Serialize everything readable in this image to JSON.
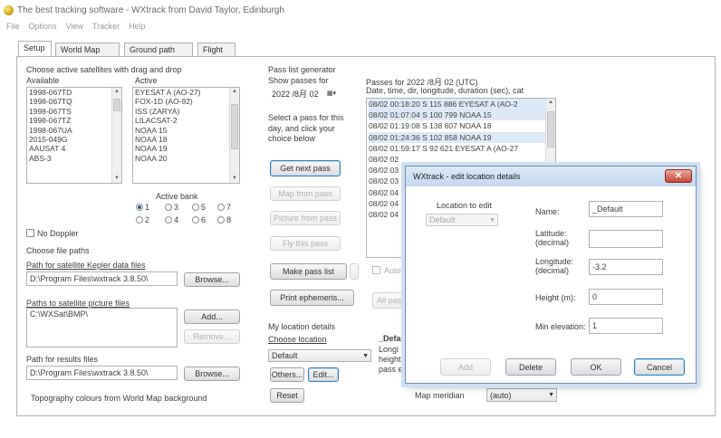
{
  "window": {
    "title": "The best tracking software - WXtrack from David Taylor, Edinburgh"
  },
  "menu": [
    "File",
    "Options",
    "View",
    "Tracker",
    "Help"
  ],
  "tabs": [
    "Setup",
    "World Map",
    "Ground path",
    "Flight"
  ],
  "satellites": {
    "group_label": "Choose active satellites with drag and drop",
    "available_label": "Available",
    "active_label": "Active",
    "available": [
      "1998-067TD",
      "1998-067TQ",
      "1998-067TS",
      "1998-067TZ",
      "1998-067UA",
      "2015-049G",
      "AAUSAT 4",
      "ABS-3"
    ],
    "active": [
      "EYESAT A (AO-27)",
      "FOX-1D (AO-92)",
      "ISS (ZARYA)",
      "LILACSAT-2",
      "NOAA 15",
      "NOAA 18",
      "NOAA 19",
      "NOAA 20"
    ],
    "bank_label": "Active bank",
    "banks": [
      "1",
      "3",
      "5",
      "7",
      "2",
      "4",
      "6",
      "8"
    ],
    "selected_bank": "1",
    "no_doppler_label": "No Doppler"
  },
  "file_paths": {
    "group_label": "Choose file paths",
    "kepler_label": "Path for satellite Kepler data files",
    "kepler_value": "D:\\Program Files\\wxtrack 3.8.50\\",
    "browse_label": "Browse...",
    "pictures_label": "Paths to satellite picture files",
    "pictures_value": "C:\\WXSat\\BMP\\",
    "add_label": "Add...",
    "remove_label": "Remove...",
    "results_label": "Path for results files",
    "results_value": "D:\\Program Files\\wxtrack 3.8.50\\",
    "browse2_label": "Browse...",
    "topography_label": "Topography colours from World Map background"
  },
  "pass_list": {
    "group_label": "Pass list generator",
    "show_passes_label": "Show passes for",
    "date_value": "2022 /8月 02",
    "passes_header": "Passes for 2022 /8月 02 (UTC)",
    "columns_header": "Date, time, dir, longitude, duration (sec), cat",
    "passes": [
      "08/02 00:18:20 S 115 886 EYESAT A (AO-2",
      "08/02 01:07:04 S 100 799 NOAA 15",
      "08/02 01:19:08 S 138 607 NOAA 18",
      "08/02 01:24:36 S 102 858 NOAA 19",
      "08/02 01:59:17 S 92 621 EYESAT A (AO-27",
      "08/02 02",
      "08/02 03",
      "08/02 03",
      "08/02 04",
      "08/02 04",
      "08/02 04"
    ],
    "instructions": [
      "Select a pass for this",
      "day, and click your",
      "choice below"
    ],
    "get_next_pass": "Get next pass",
    "map_from_pass": "Map from pass",
    "picture_from_pass": "Picture from pass",
    "fly_this_pass": "Fly this pass",
    "make_pass_list": "Make pass list",
    "print_ephemeris": "Print ephemeris...",
    "auto_label": "Auto",
    "all_passes": "All pas"
  },
  "location": {
    "group_label": "My location details",
    "choose_label": "Choose location",
    "selected": "Default",
    "others": "Others...",
    "edit": "Edit...",
    "reset": "Reset",
    "info_title": "_Defa",
    "info_lines": [
      "Longi",
      "height",
      "pass e"
    ],
    "map_meridian_label": "Map meridian",
    "map_meridian_value": "(auto)"
  },
  "dialog": {
    "title": "WXtrack - edit location details",
    "location_group": "Location to edit",
    "location_value": "Default",
    "name_label": "Name:",
    "name_value": "_Default",
    "latitude_label": "Latitude:\n(decimal)",
    "latitude_value": "",
    "longitude_label": "Longitude:\n(decimal)",
    "longitude_value": "-3.2",
    "height_label": "Height (m):",
    "height_value": "0",
    "min_elevation_label": "Min elevation:",
    "min_elevation_value": "1",
    "add": "Add",
    "delete": "Delete",
    "ok": "OK",
    "cancel": "Cancel"
  }
}
